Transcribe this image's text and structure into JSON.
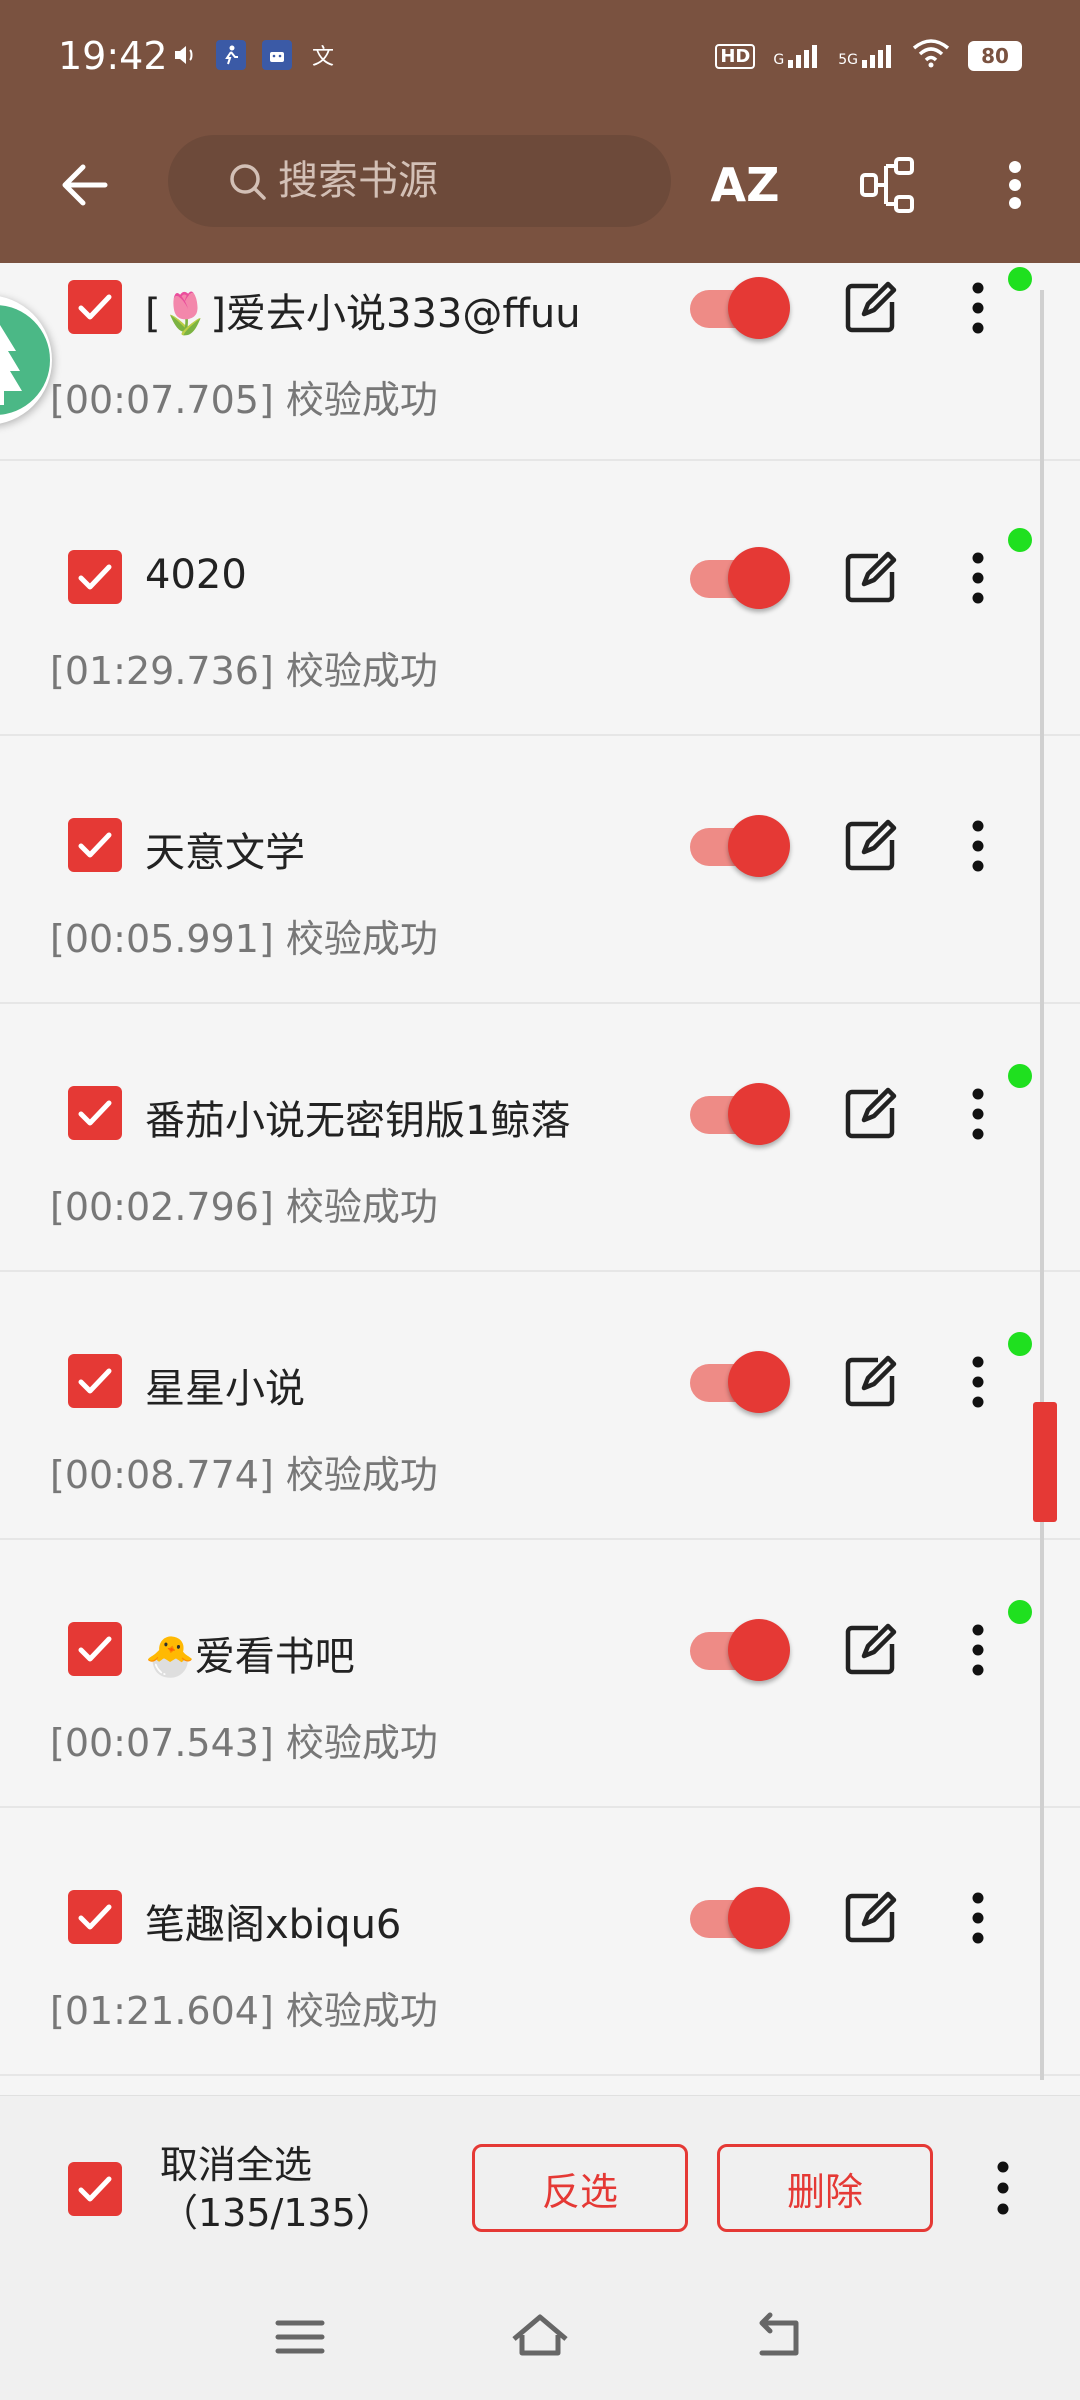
{
  "status_bar": {
    "time": "19:42",
    "left_icons": [
      "volume-icon",
      "runner-app-icon",
      "android-app-icon",
      "pinyin-icon"
    ],
    "pinyin_glyph": "文",
    "hd_label": "HD",
    "signal_label_1": "G",
    "signal_label_2": "5G",
    "battery": "80"
  },
  "toolbar": {
    "search_placeholder": "搜索书源",
    "sort_label": "AZ"
  },
  "sources": [
    {
      "name": "[🌷]爱去小说333@ffuu",
      "status": "[00:07.705] 校验成功",
      "dot": true
    },
    {
      "name": "4020",
      "status": "[01:29.736] 校验成功",
      "dot": true
    },
    {
      "name": "天意文学",
      "status": "[00:05.991] 校验成功",
      "dot": false
    },
    {
      "name": "番茄小说无密钥版1鲸落",
      "status": "[00:02.796] 校验成功",
      "dot": true
    },
    {
      "name": "星星小说",
      "status": "[00:08.774] 校验成功",
      "dot": true
    },
    {
      "name": "🐣爱看书吧",
      "status": "[00:07.543] 校验成功",
      "dot": true
    },
    {
      "name": "笔趣阁xbiqu6",
      "status": "[01:21.604] 校验成功",
      "dot": false
    }
  ],
  "bottom_bar": {
    "select_label": "取消全选",
    "count": "（135/135）",
    "invert_label": "反选",
    "delete_label": "删除"
  },
  "colors": {
    "toolbar_bg": "#7a5240",
    "accent": "#e53935",
    "online_dot": "#1fe01f"
  }
}
